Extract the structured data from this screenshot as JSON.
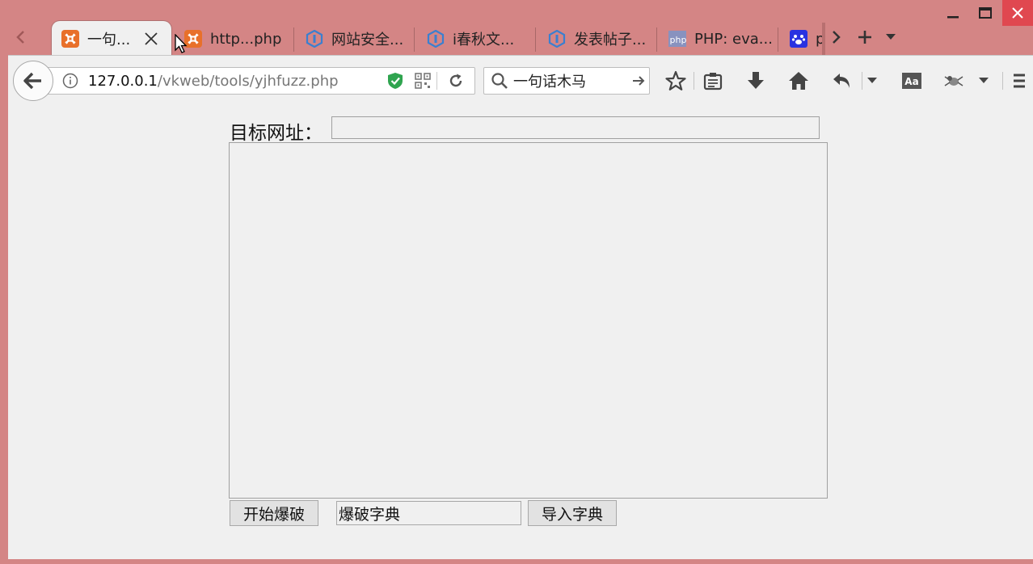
{
  "browser": {
    "tabs": [
      {
        "label": "一句...",
        "favicon": "xampp-icon",
        "active": true
      },
      {
        "label": "http...php",
        "favicon": "xampp-icon"
      },
      {
        "label": "网站安全...",
        "favicon": "ichunqiu-icon"
      },
      {
        "label": "i春秋文...",
        "favicon": "ichunqiu-icon"
      },
      {
        "label": "发表帖子...",
        "favicon": "ichunqiu-icon"
      },
      {
        "label": "PHP: eva...",
        "favicon": "php-icon"
      },
      {
        "label": "p",
        "favicon": "baidu-paw-icon"
      }
    ],
    "php_favicon_text": "php",
    "url": {
      "host": "127.0.0.1",
      "path": "/vkweb/tools/yjhfuzz.php"
    },
    "search": {
      "value": "一句话木马"
    },
    "colors": {
      "titlebar": "#d48585",
      "close_button": "#e04850",
      "chrome": "#f0f0f0"
    }
  },
  "page": {
    "target_label": "目标网址：",
    "target_value": "",
    "log_value": "",
    "start_button": "开始爆破",
    "dict_input_value": "爆破字典",
    "import_button": "导入字典"
  }
}
